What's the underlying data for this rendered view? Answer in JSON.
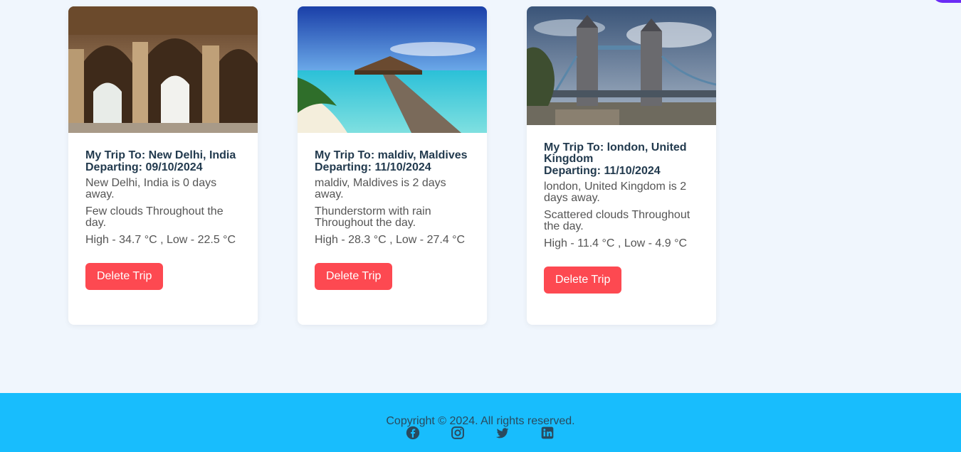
{
  "trips": [
    {
      "title": "My Trip To: New Delhi, India",
      "departing": "Departing: 09/10/2024",
      "distance": "New Delhi, India is 0 days away.",
      "weather": "Few clouds Throughout the day.",
      "temps": "High - 34.7 °C , Low - 22.5 °C",
      "delete_label": "Delete Trip",
      "image_icon": "palace-photo"
    },
    {
      "title": "My Trip To: maldiv, Maldives",
      "departing": "Departing: 11/10/2024",
      "distance": "maldiv, Maldives is 2 days away.",
      "weather": "Thunderstorm with rain Throughout the day.",
      "temps": "High - 28.3 °C , Low - 27.4 °C",
      "delete_label": "Delete Trip",
      "image_icon": "beach-photo"
    },
    {
      "title": "My Trip To: london, United Kingdom",
      "departing": "Departing: 11/10/2024",
      "distance": "london, United Kingdom is 2 days away.",
      "weather": "Scattered clouds Throughout the day.",
      "temps": "High - 11.4 °C , Low - 4.9 °C",
      "delete_label": "Delete Trip",
      "image_icon": "tower-bridge-photo"
    }
  ],
  "footer": {
    "copyright": "Copyright © 2024. All rights reserved.",
    "socials": [
      "facebook-icon",
      "instagram-icon",
      "twitter-icon",
      "linkedin-icon"
    ]
  },
  "colors": {
    "background": "#f0f6fd",
    "footer": "#18bdfd",
    "delete_button": "#fd4951",
    "title_text": "#223a4e",
    "accent_corner": "#6b2cf5"
  }
}
